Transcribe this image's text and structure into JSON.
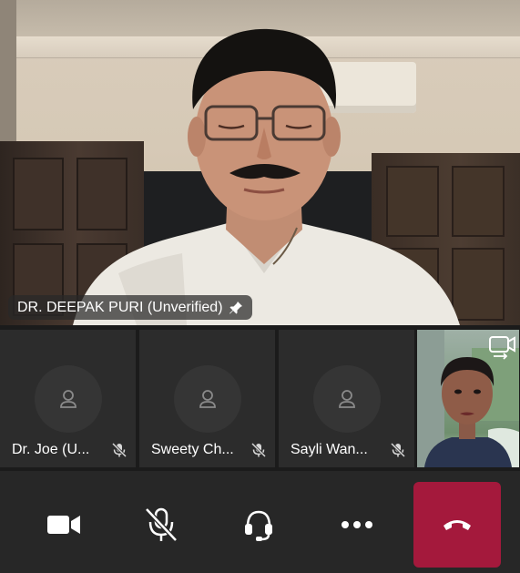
{
  "main_video": {
    "participant_name": "DR. DEEPAK PURI (Unverified)",
    "icon": "pin-icon"
  },
  "participants": [
    {
      "label": "Dr. Joe  (U...",
      "avatar_icon": "person-icon",
      "status_icon": "mic-off-icon"
    },
    {
      "label": "Sweety Ch...",
      "avatar_icon": "person-icon",
      "status_icon": "mic-off-icon"
    },
    {
      "label": "Sayli Wan...",
      "avatar_icon": "person-icon",
      "status_icon": "mic-off-icon"
    }
  ],
  "self_view": {
    "icon": "switch-camera-icon"
  },
  "controls": {
    "buttons": [
      "video-camera-icon",
      "mic-off-icon",
      "headset-icon",
      "more-icon",
      "hang-up-icon"
    ],
    "end_call_color": "#a4193c"
  }
}
